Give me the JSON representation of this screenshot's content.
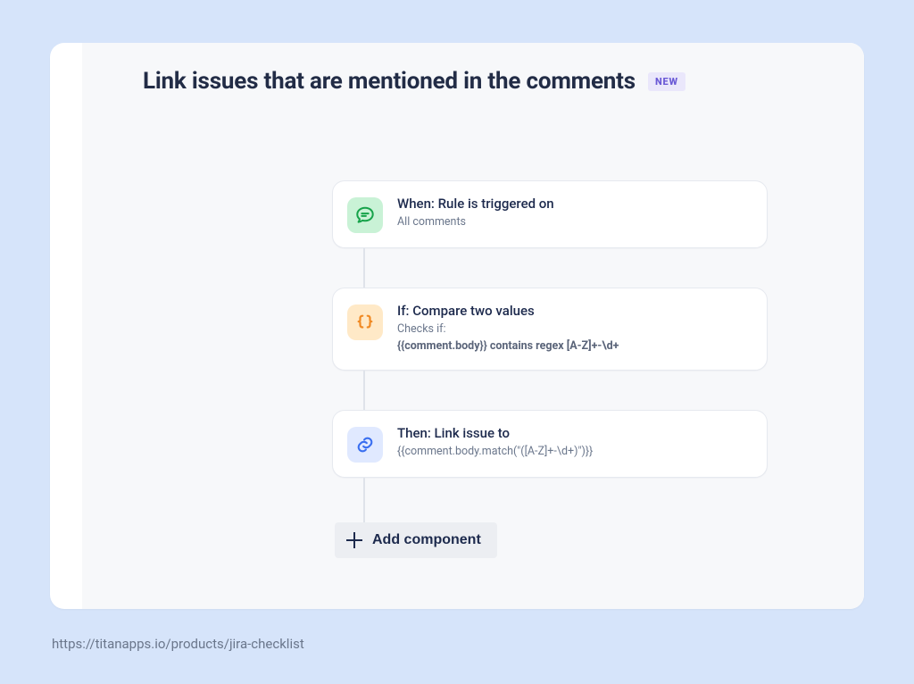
{
  "header": {
    "title": "Link issues that are mentioned in the comments",
    "badge": "NEW"
  },
  "flow": {
    "steps": [
      {
        "icon": "comment-icon",
        "title": "When: Rule is triggered on",
        "subtitle": "All comments"
      },
      {
        "icon": "braces-icon",
        "title": "If: Compare two values",
        "subtitle_label": "Checks if:",
        "subtitle_strong": "{{comment.body}} contains regex [A-Z]+-\\d+"
      },
      {
        "icon": "link-icon",
        "title": "Then: Link issue to",
        "subtitle": "{{comment.body.match(\"([A-Z]+-\\d+)\")}}"
      }
    ],
    "add_button": "Add component"
  },
  "footer": {
    "url": "https://titanapps.io/products/jira-checklist"
  }
}
